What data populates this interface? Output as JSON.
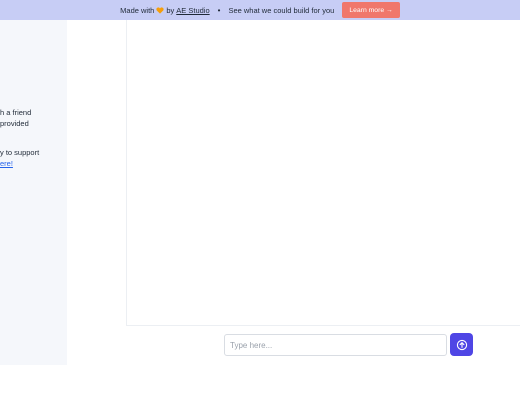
{
  "banner": {
    "made_with": "Made with",
    "by": "by",
    "studio": "AE Studio",
    "separator": "•",
    "tagline": "See what we could build for you",
    "learn_more": "Learn more →"
  },
  "sidebar": {
    "lines": [
      "h a friend",
      "provided",
      "y to support",
      "ere!"
    ]
  },
  "composer": {
    "placeholder": "Type here..."
  },
  "colors": {
    "banner_bg": "#c7cdf5",
    "cta_bg": "#f0776b",
    "send_button": "#4f46e5",
    "link": "#2563eb",
    "heart": "#f59e0b"
  },
  "icons": {
    "banner_heart": "heart-icon",
    "send": "arrow-up-circle-icon"
  }
}
